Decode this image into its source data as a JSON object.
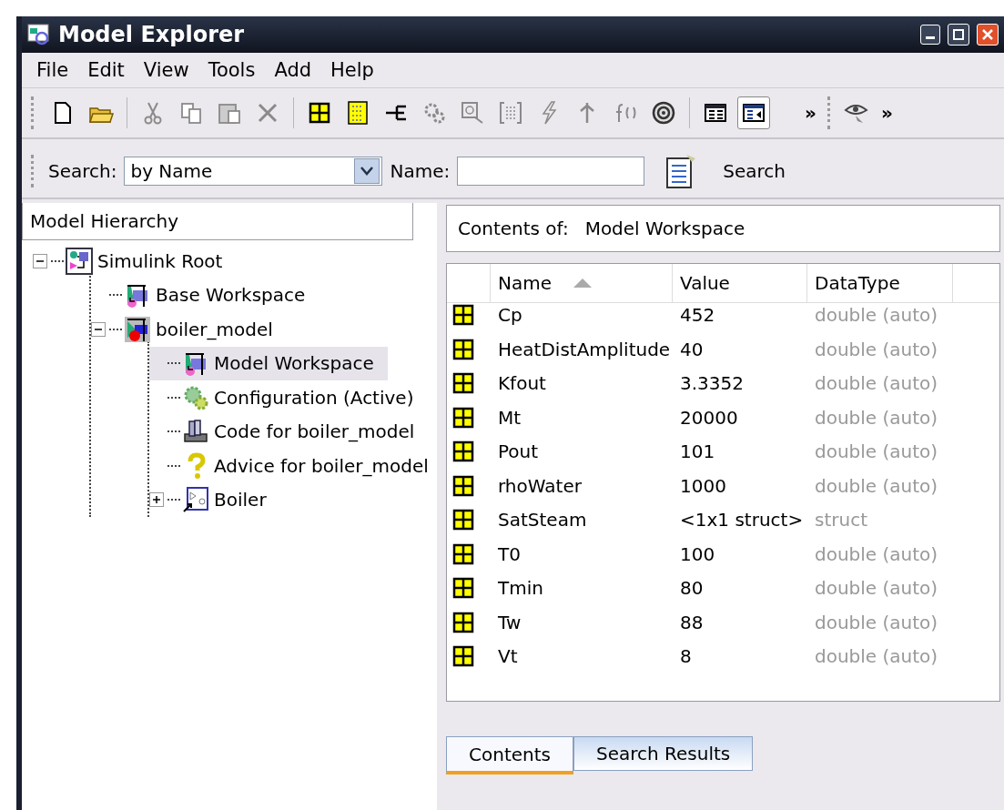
{
  "window": {
    "title": "Model Explorer"
  },
  "menu": [
    "File",
    "Edit",
    "View",
    "Tools",
    "Add",
    "Help"
  ],
  "toolbar": [
    {
      "kind": "new"
    },
    {
      "kind": "open"
    },
    {
      "kind": "sep"
    },
    {
      "kind": "cut",
      "disabled": true
    },
    {
      "kind": "copy",
      "disabled": true
    },
    {
      "kind": "paste",
      "disabled": true
    },
    {
      "kind": "delete",
      "disabled": true
    },
    {
      "kind": "sep"
    },
    {
      "kind": "variable"
    },
    {
      "kind": "matrix"
    },
    {
      "kind": "port"
    },
    {
      "kind": "gears",
      "disabled": true
    },
    {
      "kind": "scope",
      "disabled": true
    },
    {
      "kind": "bracket",
      "disabled": true
    },
    {
      "kind": "bolt",
      "disabled": true
    },
    {
      "kind": "branch",
      "disabled": true
    },
    {
      "kind": "function",
      "disabled": true
    },
    {
      "kind": "target"
    },
    {
      "kind": "sep"
    },
    {
      "kind": "panel",
      "selected": false
    },
    {
      "kind": "panel2",
      "selected": true
    }
  ],
  "toolbar_overflow": [
    "»",
    "»"
  ],
  "search_bar": {
    "label": "Search:",
    "mode": "by Name",
    "name_label": "Name:",
    "button": "Search"
  },
  "hierarchy": {
    "title": "Model Hierarchy",
    "tree": [
      {
        "label": "Simulink Root",
        "kind": "root",
        "selected": false,
        "expanded": true,
        "children": [
          {
            "label": "Base Workspace",
            "kind": "workspace",
            "selected": false
          },
          {
            "label": "boiler_model",
            "kind": "model",
            "selected": false,
            "expanded": true,
            "children": [
              {
                "label": "Model Workspace",
                "kind": "workspace",
                "selected": true
              },
              {
                "label": "Configuration (Active)",
                "kind": "config",
                "selected": false
              },
              {
                "label": "Code for boiler_model",
                "kind": "code",
                "selected": false
              },
              {
                "label": "Advice for boiler_model",
                "kind": "advice",
                "selected": false
              },
              {
                "label": "Boiler",
                "kind": "subsystem",
                "selected": false,
                "expanded": false
              }
            ]
          }
        ]
      }
    ]
  },
  "contents": {
    "label": "Contents of:",
    "value": "Model Workspace",
    "columns": [
      "Name",
      "Value",
      "DataType"
    ],
    "rows": [
      {
        "name": "Cp",
        "value": "452",
        "datatype": "double (auto)"
      },
      {
        "name": "HeatDistAmplitude",
        "value": "40",
        "datatype": "double (auto)"
      },
      {
        "name": "Kfout",
        "value": "3.3352",
        "datatype": "double (auto)"
      },
      {
        "name": "Mt",
        "value": "20000",
        "datatype": "double (auto)"
      },
      {
        "name": "Pout",
        "value": "101",
        "datatype": "double (auto)"
      },
      {
        "name": "rhoWater",
        "value": "1000",
        "datatype": "double (auto)"
      },
      {
        "name": "SatSteam",
        "value": "<1x1 struct>",
        "datatype": "struct"
      },
      {
        "name": "T0",
        "value": "100",
        "datatype": "double (auto)"
      },
      {
        "name": "Tmin",
        "value": "80",
        "datatype": "double (auto)"
      },
      {
        "name": "Tw",
        "value": "88",
        "datatype": "double (auto)"
      },
      {
        "name": "Vt",
        "value": "8",
        "datatype": "double (auto)"
      }
    ]
  },
  "tabs": [
    {
      "label": "Contents",
      "selected": true
    },
    {
      "label": "Search Results",
      "selected": false
    }
  ]
}
